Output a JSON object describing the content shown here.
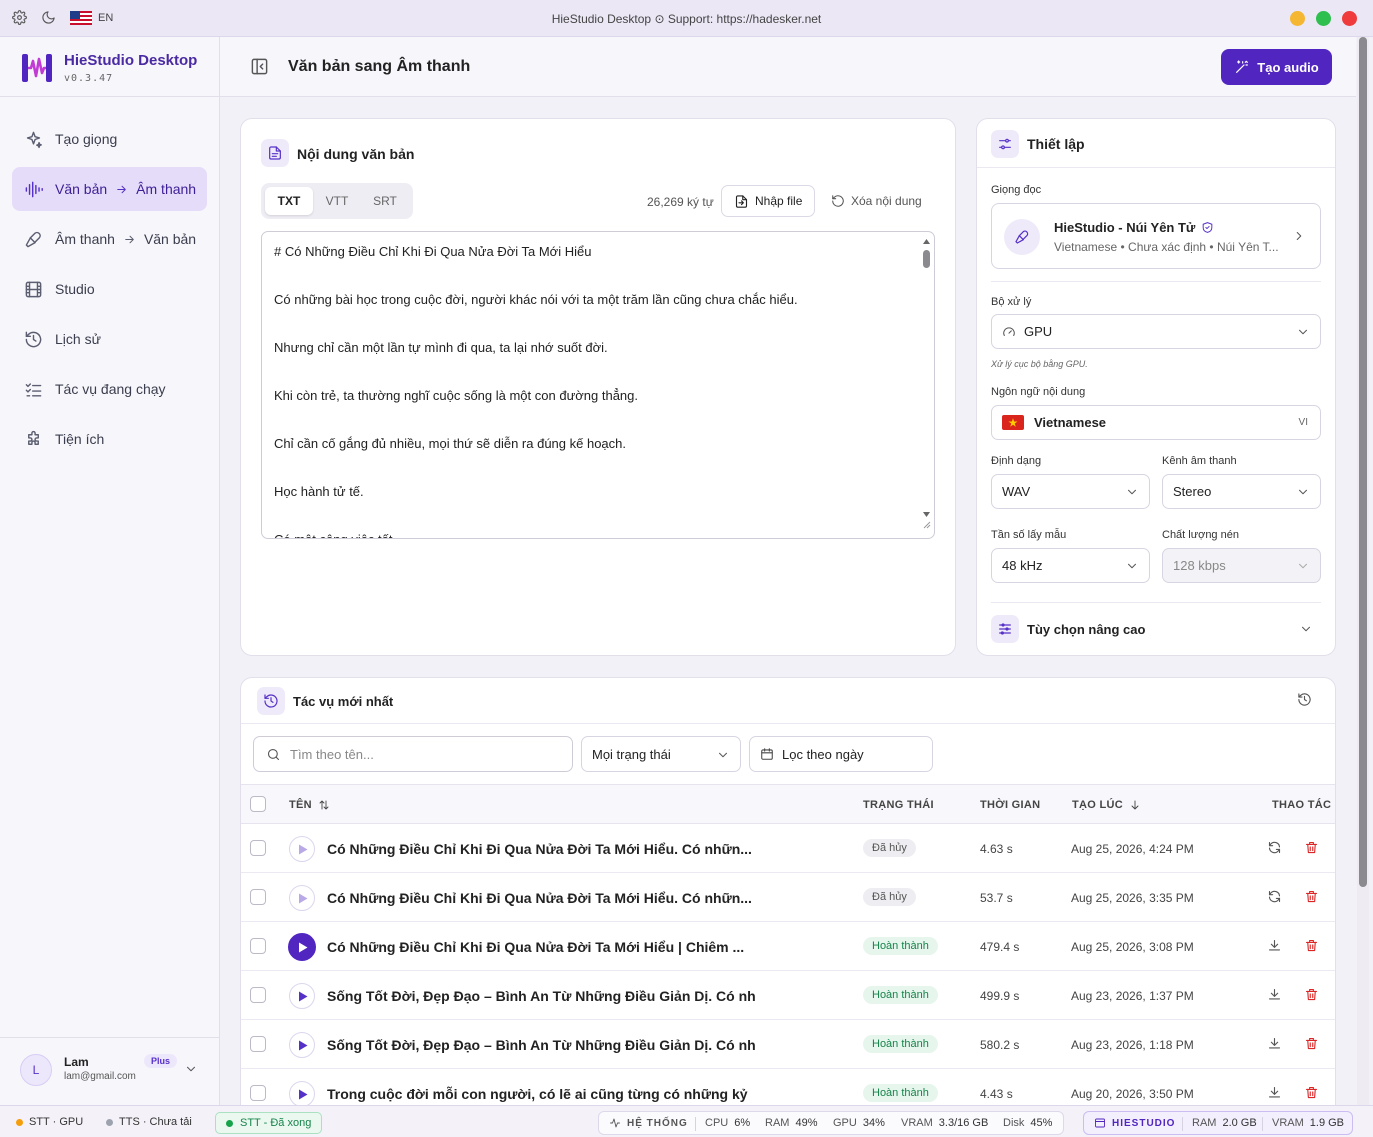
{
  "titlebar": {
    "lang": "EN",
    "title": "HieStudio Desktop ⊙ Support: https://hadesker.net",
    "dots": {
      "yellow": "#f5b731",
      "green": "#2fbf4f",
      "red": "#ef3b3b"
    }
  },
  "brand": {
    "name": "HieStudio Desktop",
    "version": "v0.3.47",
    "color": "#5126c0"
  },
  "nav": {
    "items": [
      {
        "icon": "sparkle-icon",
        "label": "Tạo giọng"
      },
      {
        "icon": "waveform-icon",
        "label": "Văn bản",
        "label2": "Âm thanh"
      },
      {
        "icon": "microphone-icon",
        "label": "Âm thanh",
        "label2": "Văn bản"
      },
      {
        "icon": "film-icon",
        "label": "Studio"
      },
      {
        "icon": "history-icon",
        "label": "Lịch sử"
      },
      {
        "icon": "tasklist-icon",
        "label": "Tác vụ đang chạy"
      },
      {
        "icon": "puzzle-icon",
        "label": "Tiện ích"
      }
    ]
  },
  "user": {
    "initial": "L",
    "name": "Lam",
    "email": "lam@gmail.com",
    "plan": "Plus"
  },
  "header": {
    "title": "Văn bản sang Âm thanh",
    "create_label": "Tạo audio"
  },
  "text_card": {
    "title": "Nội dung văn bản",
    "tabs": [
      "TXT",
      "VTT",
      "SRT"
    ],
    "char_count": "26,269 ký tự",
    "import_label": "Nhập file",
    "clear_label": "Xóa nội dung",
    "lines": [
      "# Có Những Điều Chỉ Khi Đi Qua Nửa Đời Ta Mới Hiểu",
      "Có những bài học trong cuộc đời, người khác nói với ta một trăm lần cũng chưa chắc hiểu.",
      "Nhưng chỉ cần một lần tự mình đi qua, ta lại nhớ suốt đời.",
      "Khi còn trẻ, ta thường nghĩ cuộc sống là một con đường thẳng.",
      "Chỉ cần cố gắng đủ nhiều, mọi thứ sẽ diễn ra đúng kế hoạch.",
      "Học hành tử tế.",
      "Có một công việc tốt."
    ]
  },
  "settings": {
    "title": "Thiết lập",
    "voice_label": "Giọng đọc",
    "voice_name": "HieStudio - Núi Yên Tử",
    "voice_meta": "Vietnamese • Chưa xác định • Núi Yên T...",
    "processor_label": "Bộ xử lý",
    "processor_value": "GPU",
    "processor_hint": "Xử lý cục bộ bằng GPU.",
    "language_label": "Ngôn ngữ nội dung",
    "language_value": "Vietnamese",
    "language_code": "VI",
    "format_label": "Định dạng",
    "format_value": "WAV",
    "channel_label": "Kênh âm thanh",
    "channel_value": "Stereo",
    "samplerate_label": "Tần số lấy mẫu",
    "samplerate_value": "48 kHz",
    "bitrate_label": "Chất lượng nén",
    "bitrate_value": "128 kbps",
    "advanced_label": "Tùy chọn nâng cao"
  },
  "tasks": {
    "title": "Tác vụ mới nhất",
    "search_placeholder": "Tìm theo tên...",
    "status_filter": "Mọi trạng thái",
    "date_filter": "Lọc theo ngày",
    "columns": {
      "name": "TÊN",
      "status": "TRẠNG THÁI",
      "duration": "THỜI GIAN",
      "created": "TẠO LÚC",
      "actions": "THAO TÁC"
    },
    "rows": [
      {
        "name": "Có Những Điều Chỉ Khi Đi Qua Nửa Đời Ta Mới Hiểu. Có nhữn...",
        "status": "Đã hủy",
        "kind": "cancel",
        "duration": "4.63 s",
        "created": "Aug 25, 2026, 4:24 PM",
        "action": "retry-icon"
      },
      {
        "name": "Có Những Điều Chỉ Khi Đi Qua Nửa Đời Ta Mới Hiểu. Có nhữn...",
        "status": "Đã hủy",
        "kind": "cancel",
        "duration": "53.7 s",
        "created": "Aug 25, 2026, 3:35 PM",
        "action": "retry-icon"
      },
      {
        "name": "Có Những Điều Chỉ Khi Đi Qua Nửa Đời Ta Mới Hiểu | Chiêm ...",
        "status": "Hoàn thành",
        "kind": "done",
        "duration": "479.4 s",
        "created": "Aug 25, 2026, 3:08 PM",
        "action": "download-icon"
      },
      {
        "name": "Sống Tốt Đời, Đẹp Đạo – Bình An Từ Những Điều Giản Dị. Có nh",
        "status": "Hoàn thành",
        "kind": "done",
        "duration": "499.9 s",
        "created": "Aug 23, 2026, 1:37 PM",
        "action": "download-icon"
      },
      {
        "name": "Sống Tốt Đời, Đẹp Đạo – Bình An Từ Những Điều Giản Dị. Có nh",
        "status": "Hoàn thành",
        "kind": "done",
        "duration": "580.2 s",
        "created": "Aug 23, 2026, 1:18 PM",
        "action": "download-icon"
      },
      {
        "name": "Trong cuộc đời mỗi con người, có lẽ ai cũng từng có những kỷ",
        "status": "Hoàn thành",
        "kind": "done",
        "duration": "4.43 s",
        "created": "Aug 20, 2026, 3:50 PM",
        "action": "download-icon"
      }
    ]
  },
  "statusbar": {
    "stt": "STT · GPU",
    "tts": "TTS · Chưa tải",
    "stt_done": "STT - Đã xong",
    "system_label": "HỆ THỐNG",
    "cpu_label": "CPU",
    "cpu": "6%",
    "ram_label": "RAM",
    "ram": "49%",
    "gpu_label": "GPU",
    "gpu": "34%",
    "vram_label": "VRAM",
    "vram": "3.3/16 GB",
    "disk_label": "Disk",
    "disk": "45%",
    "app_label": "HIESTUDIO",
    "app_ram_label": "RAM",
    "app_ram": "2.0 GB",
    "app_vram_label": "VRAM",
    "app_vram": "1.9 GB"
  }
}
